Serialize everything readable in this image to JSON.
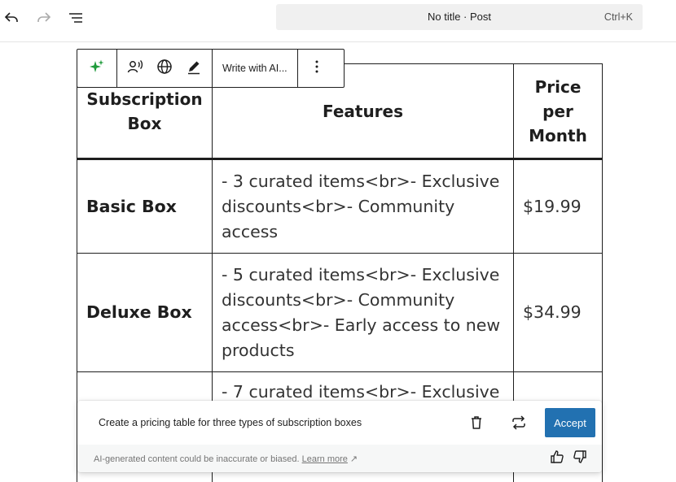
{
  "header": {
    "doc_title": "No title · Post",
    "shortcut": "Ctrl+K"
  },
  "block_toolbar": {
    "write_ai_label": "Write with AI..."
  },
  "table": {
    "headers": [
      "Subscription Box",
      "Features",
      "Price per Month"
    ],
    "rows": [
      {
        "box": "Basic Box",
        "features": "- 3 curated items<br>- Exclusive discounts<br>- Community access",
        "price": "$19.99"
      },
      {
        "box": "Deluxe Box",
        "features": "- 5 curated items<br>- Exclusive discounts<br>- Community access<br>- Early access to new products",
        "price": "$34.99"
      },
      {
        "box": "",
        "features": "- 7 curated items<br>- Exclusive",
        "price": ""
      }
    ]
  },
  "ai_panel": {
    "prompt": "Create a pricing table for three types of subscription boxes",
    "accept_label": "Accept",
    "disclaimer": "AI-generated content could be inaccurate or biased.",
    "learn_more": "Learn more",
    "external_glyph": "↗"
  },
  "colors": {
    "accent": "#2271b1",
    "ai_sparkle": "#1f9b3b"
  }
}
